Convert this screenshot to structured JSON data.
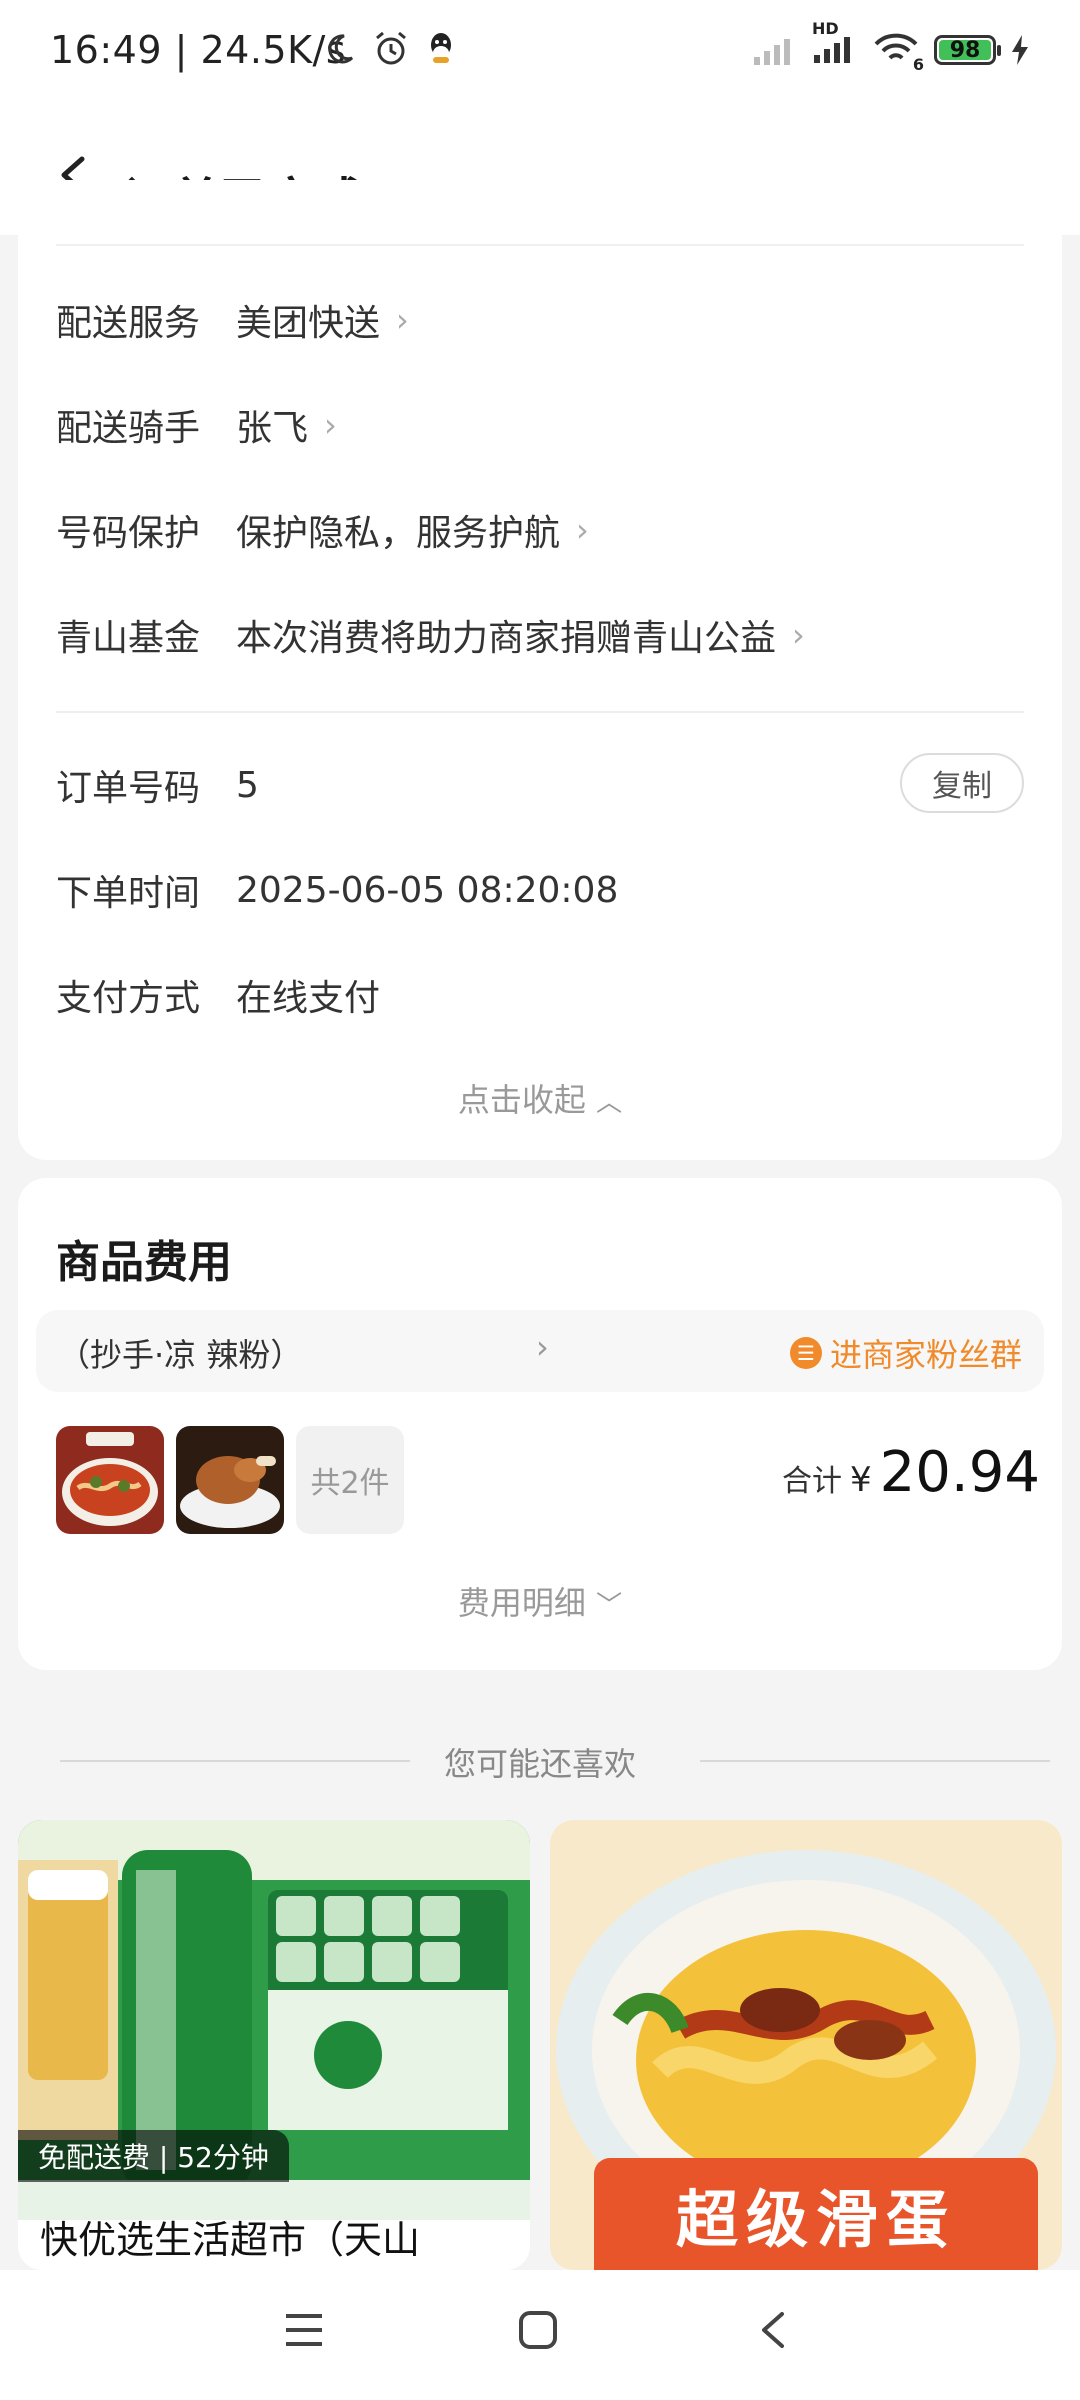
{
  "status_bar": {
    "time": "16:49",
    "speed": "24.5K/s",
    "battery": "98",
    "network_hd": "HD",
    "wifi_badge": "6",
    "icons": [
      "moon-icon",
      "alarm-icon",
      "qq-icon",
      "signal-icon",
      "wifi-icon",
      "battery-icon",
      "charging-icon"
    ]
  },
  "header": {
    "title": "订单已完成"
  },
  "delivery": {
    "rows": [
      {
        "label": "配送服务",
        "value": "美团快送"
      },
      {
        "label": "配送骑手",
        "value": "张飞"
      },
      {
        "label": "号码保护",
        "value": "保护隐私，服务护航"
      },
      {
        "label": "青山基金",
        "value": "本次消费将助力商家捐赠青山公益"
      }
    ]
  },
  "order": {
    "number_label": "订单号码",
    "number_value": "5",
    "copy_button": "复制",
    "time_label": "下单时间",
    "time_value": "2025-06-05 08:20:08",
    "pay_label": "支付方式",
    "pay_value": "在线支付",
    "collapse": "点击收起"
  },
  "goods": {
    "title": "商品费用",
    "shop_name": "（抄手·凉    辣粉）",
    "fan_group": "进商家粉丝群",
    "count": "共2件",
    "total_label": "合计",
    "currency": "¥",
    "total": "20.94",
    "detail": "费用明细"
  },
  "recommend": {
    "title": "您可能还喜欢",
    "cards": [
      {
        "badge": "免配送费 | 52分钟",
        "caption": "快优选生活超市（天山"
      },
      {
        "promo": "超级滑蛋"
      }
    ]
  },
  "colors": {
    "accent": "#f08a2a",
    "promo": "#e8552a",
    "green": "#1d8a3c"
  }
}
